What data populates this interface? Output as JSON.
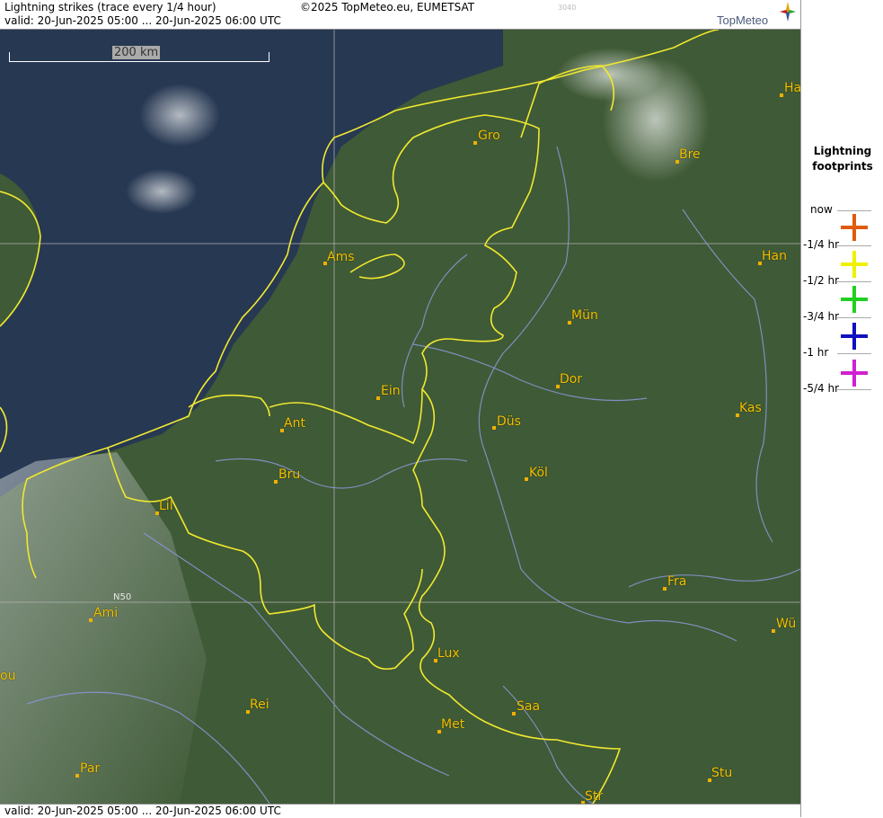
{
  "header": {
    "title": "Lightning strikes (trace every 1/4 hour)",
    "valid": "valid:  20-Jun-2025 05:00 ... 20-Jun-2025 06:00 UTC",
    "copyright": "©2025 TopMeteo.eu, EUMETSAT",
    "code": "3040",
    "logo": "TopMeteo"
  },
  "footer": {
    "valid": "valid:  20-Jun-2025 05:00 ... 20-Jun-2025 06:00 UTC"
  },
  "map": {
    "scale_label": "200 km",
    "lat_label": "N50",
    "cities": [
      {
        "label": "Gro"
      },
      {
        "label": "Bre"
      },
      {
        "label": "Ha"
      },
      {
        "label": "Ams"
      },
      {
        "label": "Han"
      },
      {
        "label": "Mün"
      },
      {
        "label": "Ein"
      },
      {
        "label": "Dor"
      },
      {
        "label": "Ant"
      },
      {
        "label": "Düs"
      },
      {
        "label": "Kas"
      },
      {
        "label": "Bru"
      },
      {
        "label": "Köl"
      },
      {
        "label": "Lil"
      },
      {
        "label": "Fra"
      },
      {
        "label": "Ami"
      },
      {
        "label": "Wü"
      },
      {
        "label": "Lux"
      },
      {
        "label": "ou"
      },
      {
        "label": "Rei"
      },
      {
        "label": "Saa"
      },
      {
        "label": "Met"
      },
      {
        "label": "Par"
      },
      {
        "label": "Stu"
      },
      {
        "label": "Str"
      }
    ]
  },
  "legend": {
    "title_line1": "Lightning",
    "title_line2": "footprints",
    "items": [
      {
        "label": "now",
        "color": "#e05a10"
      },
      {
        "label": "-1/4 hr",
        "color": "#f0f000"
      },
      {
        "label": "-1/2 hr",
        "color": "#20d020"
      },
      {
        "label": "-3/4 hr",
        "color": "#1010c0"
      },
      {
        "label": "-1 hr",
        "color": "#d020d0"
      },
      {
        "label": "-5/4 hr",
        "color": ""
      }
    ]
  }
}
